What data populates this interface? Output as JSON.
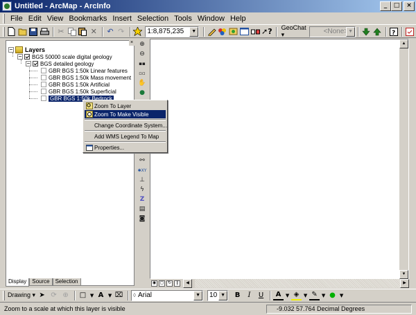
{
  "window": {
    "title": "Untitled - ArcMap - ArcInfo"
  },
  "menubar": {
    "items": [
      "File",
      "Edit",
      "View",
      "Bookmarks",
      "Insert",
      "Selection",
      "Tools",
      "Window",
      "Help"
    ]
  },
  "toolbar": {
    "scale_value": "1:8,875,235",
    "geochat_label": "GeoChat ▾",
    "none_value": "<None>"
  },
  "toc": {
    "root": "Layers",
    "group": "BGS 50000 scale digital geology",
    "subgroup": "BGS detailed geology",
    "layers": [
      "GBR BGS 1:50k Linear features",
      "GBR BGS 1:50k Mass movement",
      "GBR BGS 1:50k Artificial",
      "GBR BGS 1:50k Superficial",
      "GBR BGS 1:50k Bedrock"
    ],
    "tabs": [
      "Display",
      "Source",
      "Selection"
    ]
  },
  "context_menu": {
    "items": [
      "Zoom To Layer",
      "Zoom To Make Visible",
      "Change Coordinate System...",
      "Add WMS Legend To Map",
      "Properties..."
    ]
  },
  "drawbar": {
    "drawing_label": "Drawing ▾",
    "font_name": "Arial",
    "font_size": "10"
  },
  "statusbar": {
    "message": "Zoom to a scale at which this layer is visible",
    "coords": "-9.032  57.764 Decimal Degrees"
  },
  "icons": {
    "window_controls": [
      "minimize-icon",
      "maximize-icon",
      "close-icon"
    ],
    "vertical_tools": [
      "zoom-in-icon",
      "zoom-out-icon",
      "fixed-zoom-in-icon",
      "fixed-zoom-out-icon",
      "pan-icon",
      "full-extent-icon",
      "go-back-icon",
      "go-forward-icon",
      "select-features-icon",
      "select-elements-icon",
      "identify-icon",
      "find-icon",
      "go-to-xy-icon",
      "measure-icon",
      "hyperlink-icon",
      "time-slider-icon",
      "html-popup-icon",
      "create-viewer-icon"
    ]
  },
  "colors": {
    "titlebar_start": "#0a246a",
    "titlebar_end": "#a6caf0",
    "selection": "#0a246a",
    "chrome": "#d4d0c8"
  }
}
